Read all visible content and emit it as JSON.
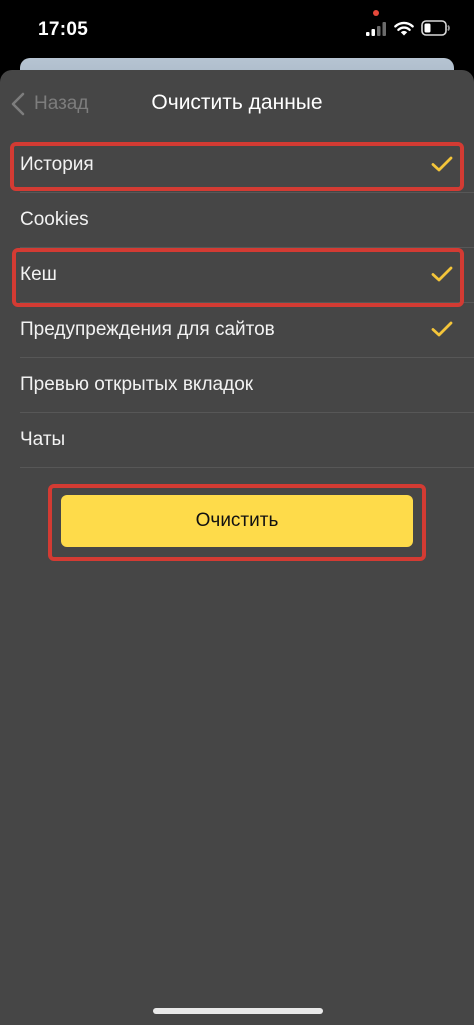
{
  "status_bar": {
    "time": "17:05",
    "icons": [
      "signal-icon",
      "wifi-icon",
      "battery-icon"
    ],
    "indicator_color": "#e5483a"
  },
  "nav": {
    "back_label": "Назад",
    "title": "Очистить данные"
  },
  "options": [
    {
      "label": "История",
      "checked": true,
      "highlighted": true
    },
    {
      "label": "Cookies",
      "checked": false,
      "highlighted": false
    },
    {
      "label": "Кеш",
      "checked": true,
      "highlighted": true
    },
    {
      "label": "Предупреждения для сайтов",
      "checked": true,
      "highlighted": false
    },
    {
      "label": "Превью открытых вкладок",
      "checked": false,
      "highlighted": false
    },
    {
      "label": "Чаты",
      "checked": false,
      "highlighted": false
    }
  ],
  "clear_button": {
    "label": "Очистить",
    "highlighted": true
  },
  "colors": {
    "sheet_background": "#464646",
    "accent_yellow": "#fedb4a",
    "check_color": "#f4c53a",
    "highlight_red": "#d33b33",
    "back_text": "#7d7d7d"
  }
}
